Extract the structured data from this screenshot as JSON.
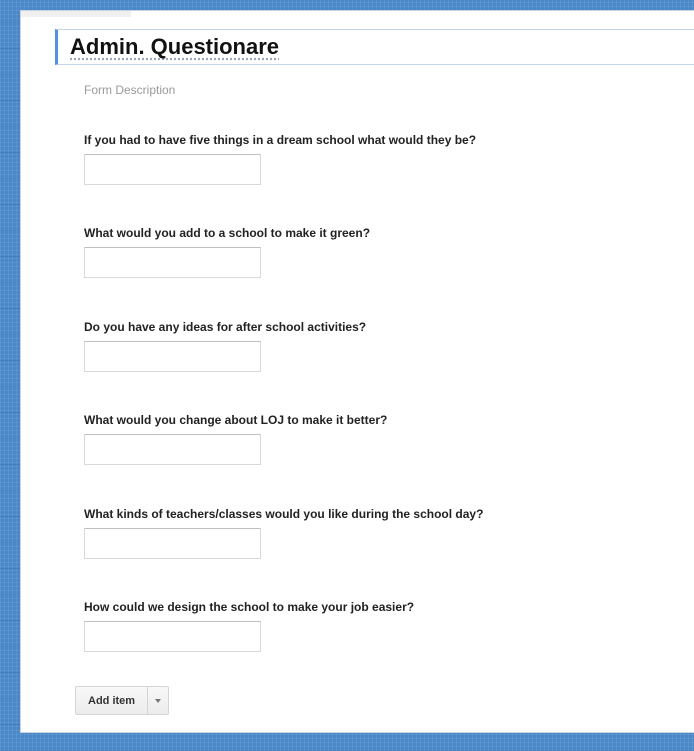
{
  "form": {
    "title": "Admin. Questionare",
    "description_placeholder": "Form Description",
    "questions": [
      {
        "label": "If you had to have five things in a dream school what would they be?",
        "answer": ""
      },
      {
        "label": "What would you add to a school to make it green?",
        "answer": ""
      },
      {
        "label": "Do you have any ideas for after school activities?",
        "answer": ""
      },
      {
        "label": "What would you change about LOJ to make it better?",
        "answer": ""
      },
      {
        "label": "What kinds of teachers/classes would you like during the school day?",
        "answer": ""
      },
      {
        "label": "How could we design the school to make your job easier?",
        "answer": ""
      }
    ]
  },
  "toolbar": {
    "add_item_label": "Add item",
    "add_item_menu_icon": "chevron-down-icon"
  },
  "colors": {
    "background": "#4a88c9",
    "title_accent": "#4d90fe",
    "panel": "#ffffff"
  }
}
